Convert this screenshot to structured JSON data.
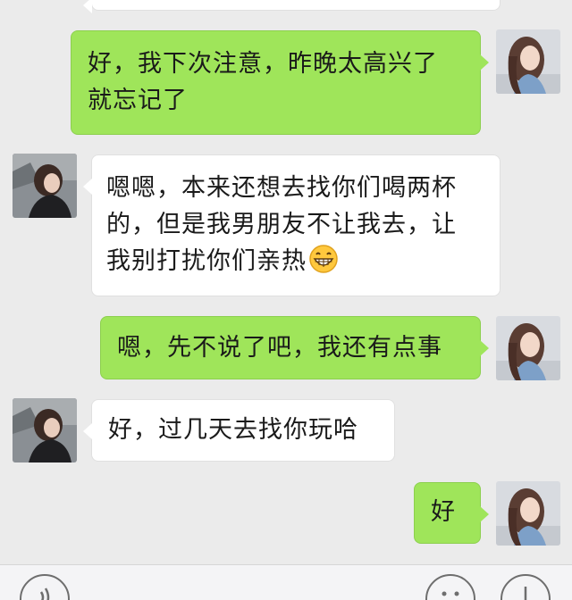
{
  "messages": [
    {
      "from": "me",
      "lines": [
        "好，我下次注意，昨晚太高兴了",
        "就忘记了"
      ]
    },
    {
      "from": "other",
      "lines": [
        "嗯嗯，本来还想去找你们喝两杯",
        "的，但是我男朋友不让我去，让",
        "我别打扰你们亲热"
      ],
      "emoji": "grinning-face-emoji"
    },
    {
      "from": "me",
      "lines": [
        "嗯，先不说了吧，我还有点事"
      ]
    },
    {
      "from": "other",
      "lines": [
        "好，过几天去找你玩哈"
      ]
    },
    {
      "from": "me",
      "lines": [
        "好"
      ]
    }
  ],
  "input_bar": {
    "icons": [
      "voice-icon",
      "emoji-icon",
      "plus-icon"
    ]
  },
  "colors": {
    "background": "#ebebeb",
    "my_bubble": "#9fe55a",
    "their_bubble": "#ffffff",
    "input_bar": "#f4f4f6"
  }
}
